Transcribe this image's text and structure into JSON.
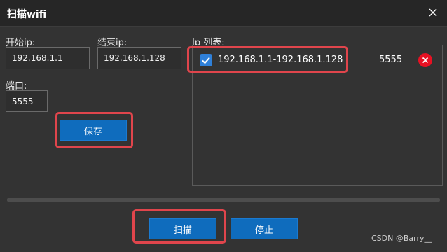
{
  "window": {
    "title": "扫描wifi"
  },
  "form": {
    "start_ip_label": "开始ip:",
    "start_ip_value": "192.168.1.1",
    "end_ip_label": "结束ip:",
    "end_ip_value": "192.168.1.128",
    "port_label": "端口:",
    "port_value": "5555",
    "save_label": "保存"
  },
  "ip_list": {
    "label": "Ip 列表:",
    "items": [
      {
        "range": "192.168.1.1-192.168.1.128",
        "port": "5555",
        "checked": true
      }
    ]
  },
  "actions": {
    "scan_label": "扫描",
    "stop_label": "停止"
  },
  "watermark": "CSDN @Barry__",
  "colors": {
    "accent": "#0f6cbd",
    "highlight": "#e0454c",
    "delete": "#e81123",
    "background": "#333333"
  }
}
